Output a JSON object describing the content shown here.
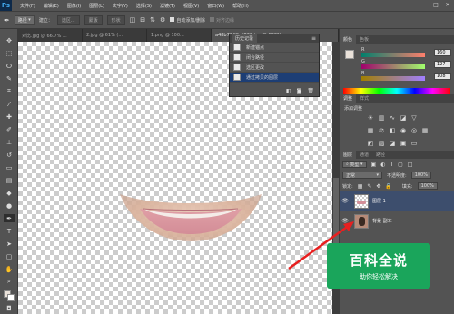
{
  "app": {
    "logo": "Ps"
  },
  "menus": [
    "文件(F)",
    "编辑(E)",
    "图像(I)",
    "图层(L)",
    "文字(Y)",
    "选择(S)",
    "滤镜(T)",
    "视图(V)",
    "窗口(W)",
    "帮助(H)"
  ],
  "window_controls": [
    "–",
    "□",
    "✕"
  ],
  "options_bar": {
    "tool_icon": "pen-icon",
    "mode_label": "路径",
    "build_label": "建立：",
    "selection_button": "选区...",
    "mask_button": "蒙版",
    "shape_button": "形状",
    "auto_add_delete_label": "自动添加/删除",
    "align_edges_label": "对齐边缘"
  },
  "document_tabs": [
    {
      "label": "对比.jpg @ 66.7% ..."
    },
    {
      "label": "2.jpg @ 61% (..."
    },
    {
      "label": "1.png @ 100..."
    },
    {
      "label": "a48b764ffcd837.jpg @ 100%..."
    }
  ],
  "history_panel": {
    "tab": "历史记录",
    "items": [
      {
        "label": "新建锚点",
        "selected": false
      },
      {
        "label": "闭合路径",
        "selected": false
      },
      {
        "label": "选区更改",
        "selected": false
      },
      {
        "label": "通过拷贝的图层",
        "selected": true
      }
    ]
  },
  "color_panel": {
    "tabs": [
      "颜色",
      "色板"
    ],
    "channels": [
      {
        "label": "R",
        "value": "160"
      },
      {
        "label": "G",
        "value": "127"
      },
      {
        "label": "B",
        "value": "108"
      }
    ],
    "colors": {
      "foreground": "#eae2da",
      "background": "#ffffff"
    }
  },
  "adjustments_panel": {
    "tabs": [
      "调整",
      "样式"
    ],
    "title": "添加调整"
  },
  "layers_panel": {
    "tabs": [
      "图层",
      "通道",
      "路径"
    ],
    "filter_label": "类型",
    "blend_mode": "正常",
    "opacity_label": "不透明度:",
    "opacity_value": "100%",
    "lock_label": "锁定:",
    "fill_label": "填充:",
    "fill_value": "100%",
    "layers": [
      {
        "name": "图层 1",
        "selected": true
      },
      {
        "name": "背景 副本",
        "selected": false
      }
    ]
  },
  "watermark": {
    "title": "百科全说",
    "subtitle": "助你轻松解决"
  }
}
